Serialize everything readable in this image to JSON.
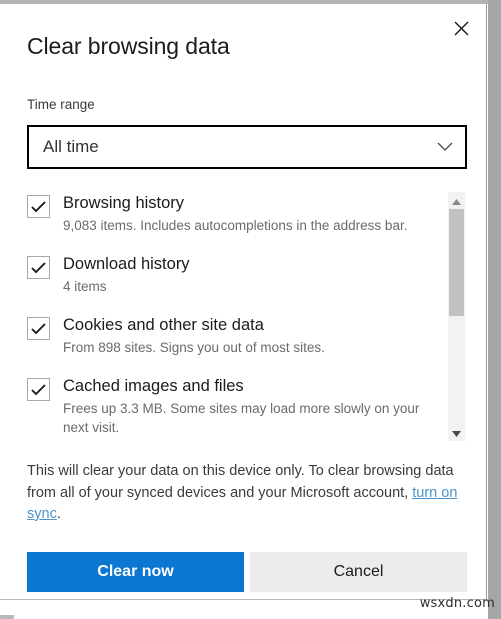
{
  "dialog": {
    "title": "Clear browsing data",
    "close_label": "Close",
    "close_icon": "close-icon"
  },
  "time_range": {
    "label": "Time range",
    "selected": "All time",
    "chevron_icon": "chevron-down-icon"
  },
  "data_types": [
    {
      "title": "Browsing history",
      "description": "9,083 items. Includes autocompletions in the address bar.",
      "checked": true
    },
    {
      "title": "Download history",
      "description": "4 items",
      "checked": true
    },
    {
      "title": "Cookies and other site data",
      "description": "From 898 sites. Signs you out of most sites.",
      "checked": true
    },
    {
      "title": "Cached images and files",
      "description": "Frees up 3.3 MB. Some sites may load more slowly on your next visit.",
      "checked": true
    }
  ],
  "scrollbar": {
    "up_icon": "triangle-up-icon",
    "down_icon": "triangle-down-icon"
  },
  "note": {
    "text_before": "This will clear your data on this device only. To clear browsing data from all of your synced devices and your Microsoft account, ",
    "link_text": "turn on sync",
    "text_after": "."
  },
  "buttons": {
    "primary": "Clear now",
    "secondary": "Cancel"
  },
  "watermark": "wsxdn.com",
  "colors": {
    "accent": "#0b77d0",
    "link": "#4b94c9",
    "secondary_button": "#ececed",
    "checkmark": "#1b1b1b"
  }
}
